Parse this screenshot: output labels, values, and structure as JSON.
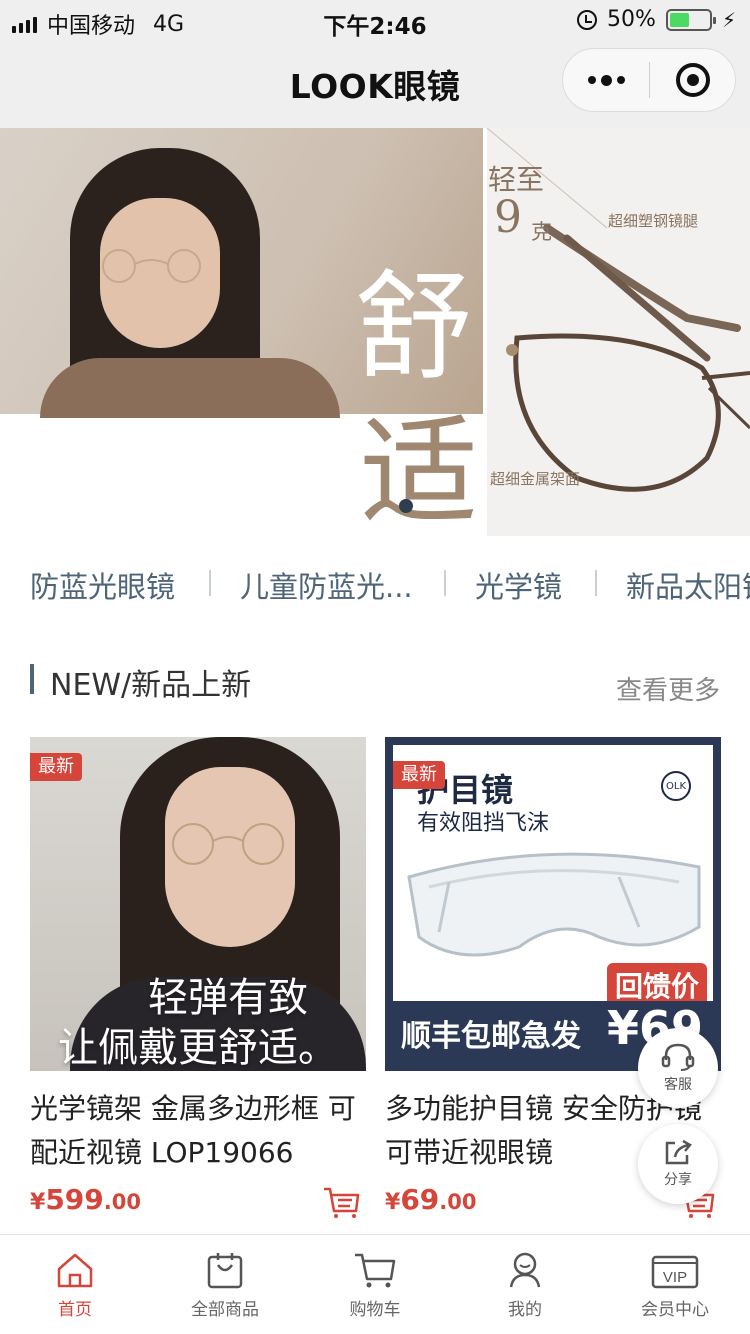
{
  "status_bar": {
    "carrier": "中国移动",
    "network": "4G",
    "time": "下午2:46",
    "battery_percent": "50%",
    "battery_level": 0.5
  },
  "header": {
    "title": "LOOK眼镜"
  },
  "banner": {
    "big_char_1": "舒",
    "big_char_2": "适",
    "light_text": "轻至",
    "weight_num": "9",
    "weight_unit": "克",
    "tag_temple": "超细塑钢镜腿",
    "tag_frame": "超细金属架面",
    "active_slide": 1
  },
  "categories": [
    {
      "label": "防蓝光眼镜"
    },
    {
      "label": "儿童防蓝光..."
    },
    {
      "label": "光学镜"
    },
    {
      "label": "新品太阳镜"
    }
  ],
  "section": {
    "title": "NEW/新品上新",
    "more_label": "查看更多"
  },
  "products": [
    {
      "badge": "最新",
      "title": "光学镜架 金属多边形框 可配近视镜 LOP19066",
      "price_symbol": "¥",
      "price_int": "599",
      "price_dec": ".00",
      "overlay_1": "轻弹有致",
      "overlay_2": "让佩戴更舒适。"
    },
    {
      "badge": "最新",
      "title": "多功能护目镜 安全防护镜 可带近视眼镜",
      "price_symbol": "¥",
      "price_int": "69",
      "price_dec": ".00",
      "img_head": "护目镜",
      "img_sub": "有效阻挡飞沫",
      "img_logo": "OLK",
      "img_price_tag": "回馈价",
      "img_bottom": "顺丰包邮急发",
      "img_bottom_price": "¥69"
    }
  ],
  "floating": {
    "customer_service": "客服",
    "share": "分享"
  },
  "tab_bar": {
    "items": [
      {
        "label": "首页",
        "icon": "home-icon",
        "active": true
      },
      {
        "label": "全部商品",
        "icon": "bag-icon",
        "active": false
      },
      {
        "label": "购物车",
        "icon": "cart-icon",
        "active": false
      },
      {
        "label": "我的",
        "icon": "user-icon",
        "active": false
      },
      {
        "label": "会员中心",
        "icon": "vip-icon",
        "active": false
      }
    ]
  },
  "colors": {
    "accent": "#d6453a",
    "category_text": "#4e6478",
    "banner_tone": "#a08770"
  }
}
